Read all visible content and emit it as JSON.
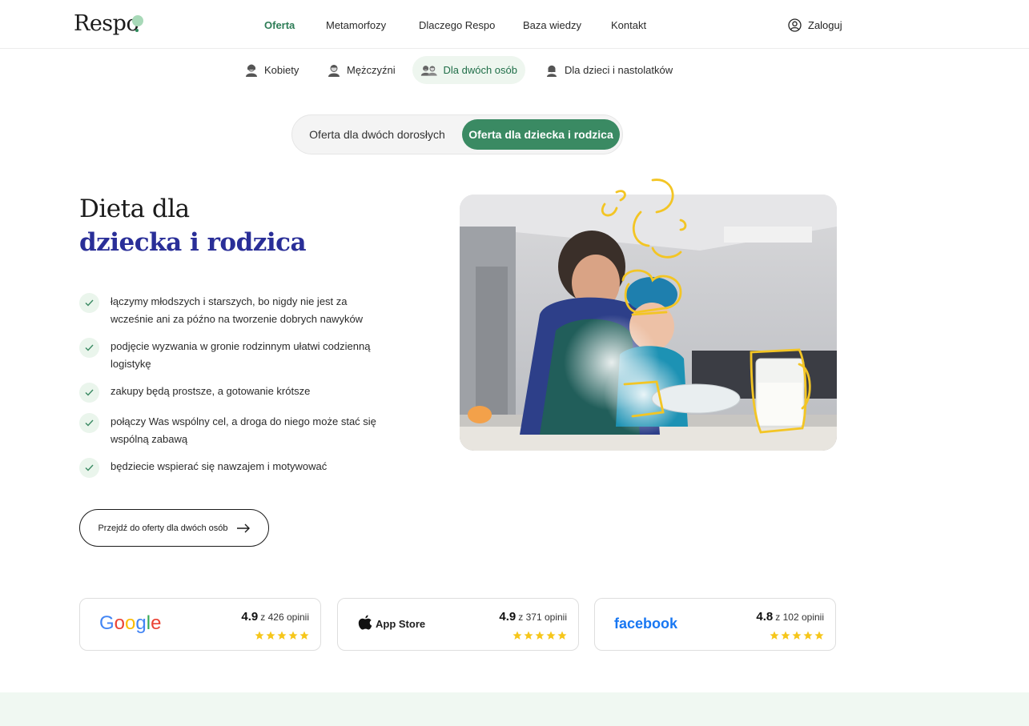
{
  "header": {
    "logo": "Respo",
    "nav": [
      "Oferta",
      "Metamorfozy",
      "Dlaczego Respo",
      "Baza wiedzy",
      "Kontakt"
    ],
    "active_nav": "Oferta",
    "login_label": "Zaloguj"
  },
  "subnav": {
    "items": [
      "Kobiety",
      "Mężczyźni",
      "Dla dwóch osób",
      "Dla dzieci i nastolatków"
    ],
    "active": "Dla dwóch osób"
  },
  "toggle": {
    "option_left": "Oferta dla dwóch dorosłych",
    "option_right": "Oferta dla dziecka i rodzica",
    "selected": "Oferta dla dziecka i rodzica"
  },
  "hero": {
    "title_line1": "Dieta dla",
    "title_line2": "dziecka i rodzica",
    "benefits": [
      "łączymy młodszych i starszych, bo nigdy nie jest za wcześnie ani za późno na tworzenie dobrych nawyków",
      "podjęcie wyzwania w gronie rodzinnym ułatwi codzienną logistykę",
      "zakupy będą prostsze, a gotowanie krótsze",
      "połączy Was wspólny cel, a droga do niego może stać się wspólną zabawą",
      "będziecie wspierać się nawzajem i motywować"
    ],
    "cta_label": "Przejdź do oferty dla dwóch osób"
  },
  "reviews": [
    {
      "brand": "Google",
      "rating": "4.9",
      "count_text": "z 426 opinii",
      "stars": 5
    },
    {
      "brand": "App Store",
      "rating": "4.9",
      "count_text": "z 371 opinii",
      "stars": 5
    },
    {
      "brand": "facebook",
      "rating": "4.8",
      "count_text": "z 102 opinii",
      "stars": 5
    }
  ],
  "colors": {
    "brand_green": "#3a8a63",
    "title_blue": "#2a2f98",
    "star_yellow": "#f6c61a",
    "footer_band": "#f0f8f2"
  }
}
